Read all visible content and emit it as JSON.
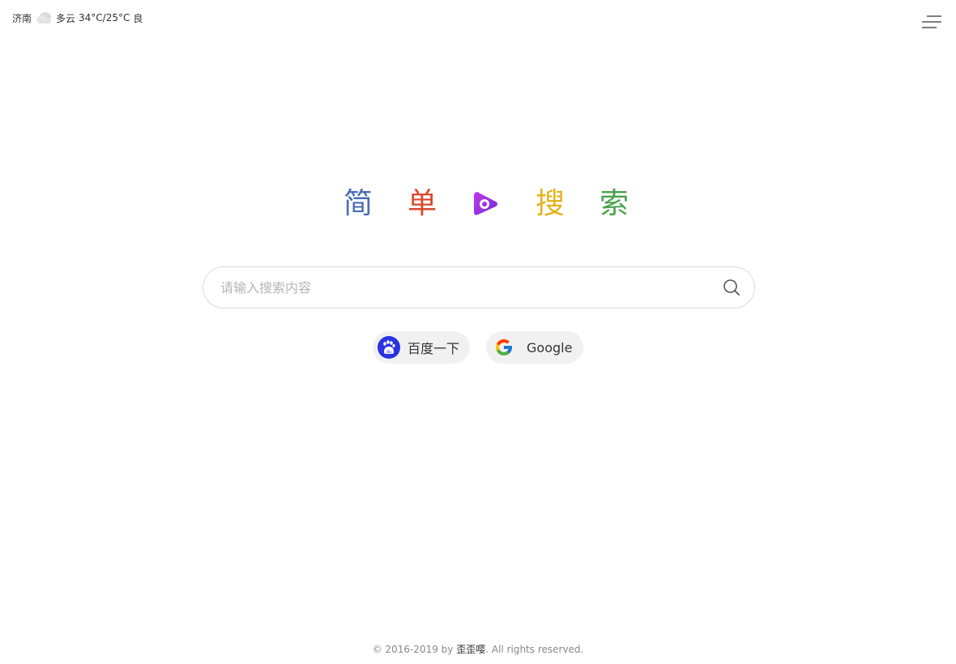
{
  "weather": {
    "city": "济南",
    "icon": "cloudy-icon",
    "condition": "多云",
    "temperature": "34°C/25°C",
    "air_quality": "良"
  },
  "menu": {
    "icon": "menu-icon"
  },
  "logo": {
    "chars": [
      "简",
      "单",
      "搜",
      "索"
    ],
    "colors": [
      "#4a6cb3",
      "#d9472b",
      "#e3b21b",
      "#4aa24e"
    ],
    "mark_icon": "play-mark-icon",
    "mark_colors": [
      "#b02ee8",
      "#7a2de0"
    ]
  },
  "search": {
    "placeholder": "请输入搜索内容",
    "value": "",
    "icon": "search-icon"
  },
  "engines": [
    {
      "label": "百度一下",
      "icon": "baidu-paw-icon",
      "color": "#2932e1"
    },
    {
      "label": "Google",
      "icon": "google-g-icon"
    }
  ],
  "footer": {
    "prefix": "© 2016-2019 by",
    "author": "歪歪嘤",
    "suffix": ". All rights reserved."
  }
}
